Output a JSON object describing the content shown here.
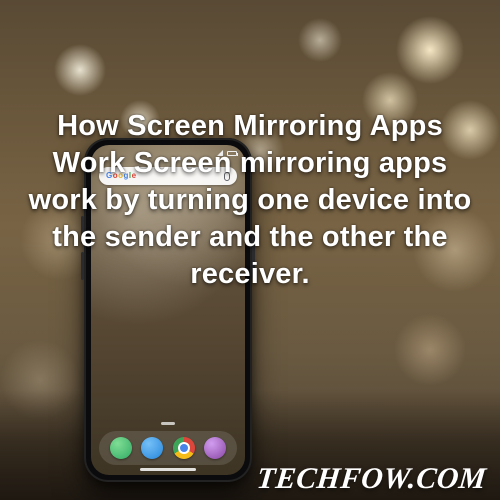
{
  "overlay": {
    "main_text": "How Screen Mirroring Apps Work Screen mirroring apps work by turning one device into the sender and the other the receiver."
  },
  "watermark": {
    "text": "TECHFOW.COM"
  },
  "phone": {
    "statusbar": {
      "time": ""
    },
    "search": {
      "brand": [
        "G",
        "o",
        "o",
        "g",
        "l",
        "e"
      ]
    },
    "dock": {
      "items": [
        {
          "name": "phone"
        },
        {
          "name": "messages"
        },
        {
          "name": "chrome"
        },
        {
          "name": "camera"
        }
      ]
    }
  }
}
